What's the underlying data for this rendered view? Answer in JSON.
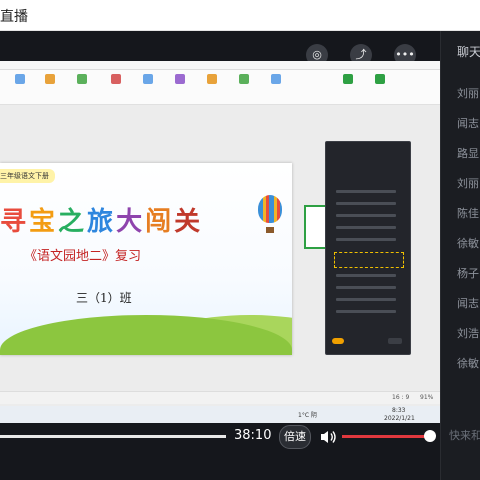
{
  "app": {
    "title": "直播"
  },
  "chat_panel": {
    "title": "聊天",
    "messages": [
      "刘丽",
      "闻志",
      "路显",
      "刘丽",
      "陈佳",
      "徐敏",
      "杨子",
      "闻志",
      "刘浩",
      "徐敏"
    ],
    "input_placeholder": "快来和"
  },
  "stage_controls": [
    "camera-switch",
    "share",
    "more"
  ],
  "slide": {
    "banner": "三年级语文下册",
    "title": "寻宝之旅大闯关",
    "subtitle": "《语文园地二》复习",
    "class_label": "三（1）班"
  },
  "ppt": {
    "zoom": "91%",
    "ratio": "16 : 9"
  },
  "taskbar": {
    "weather": "1°C 阴",
    "time": "8:33",
    "date": "2022/1/21"
  },
  "player": {
    "elapsed": "38:10",
    "speed_label": "倍速",
    "volume_level": 0.98
  },
  "colors": {
    "volume_fill": "#e0383e",
    "title_colors": [
      "#e84c3d",
      "#f39c12",
      "#27ae60",
      "#2e86de",
      "#8e44ad",
      "#e67e22",
      "#c0392b"
    ]
  }
}
